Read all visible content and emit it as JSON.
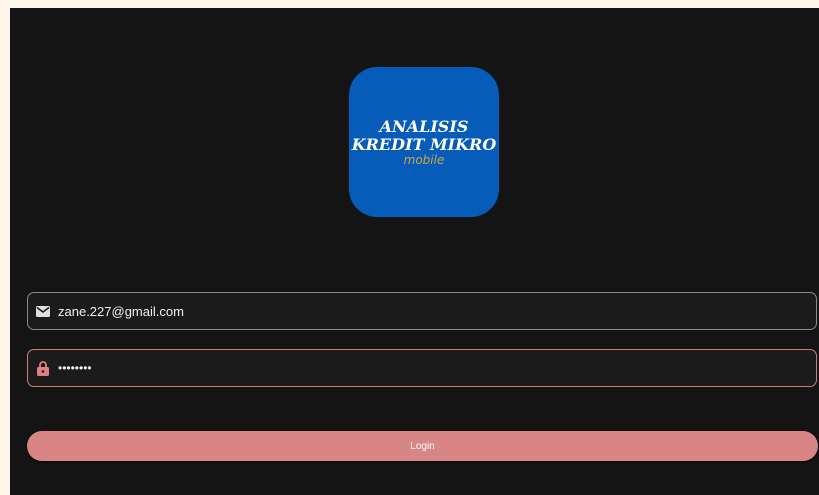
{
  "logo": {
    "line1": "ANALISIS",
    "line2": "KREDIT MIKRO",
    "line3": "mobile",
    "background_color": "#065cb8",
    "subtitle_color": "#c9a64a"
  },
  "email_field": {
    "icon": "mail-icon",
    "value": "zane.227@gmail.com"
  },
  "password_field": {
    "icon": "lock-icon",
    "value": "••••••••",
    "accent_color": "#d07a7c"
  },
  "login_button": {
    "label": "Login",
    "color": "#d98586"
  },
  "colors": {
    "page_background": "#fdf5ea",
    "app_background": "#141414"
  }
}
